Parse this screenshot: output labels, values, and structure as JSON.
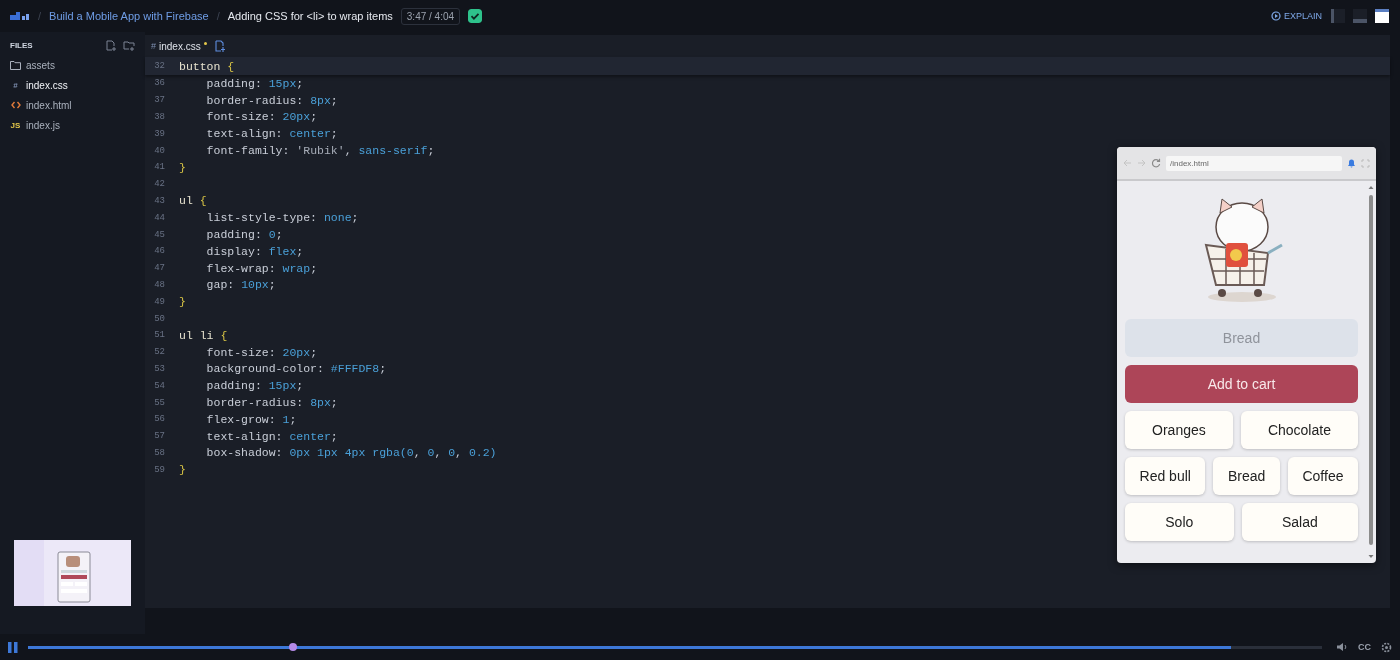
{
  "topbar": {
    "separator": "/",
    "breadcrumb": [
      {
        "label": "Build a Mobile App with Firebase",
        "kind": "link"
      },
      {
        "label": "Adding CSS for <li> to wrap items",
        "kind": "current"
      }
    ],
    "time": "3:47 / 4:04",
    "completed": true,
    "explain_label": "EXPLAIN"
  },
  "sidebar": {
    "title": "FILES",
    "files": [
      {
        "name": "assets",
        "kind": "folder",
        "selected": false
      },
      {
        "name": "index.css",
        "kind": "css",
        "glyph": "#",
        "selected": true
      },
      {
        "name": "index.html",
        "kind": "html",
        "selected": false
      },
      {
        "name": "index.js",
        "kind": "js",
        "glyph": "JS",
        "selected": false
      }
    ]
  },
  "editor": {
    "tab": {
      "glyph": "#",
      "name": "index.css",
      "modified": true
    },
    "sticky_line": {
      "num": "32",
      "code": "button {"
    },
    "lines": [
      {
        "num": "36",
        "code": "    padding: 15px;"
      },
      {
        "num": "37",
        "code": "    border-radius: 8px;"
      },
      {
        "num": "38",
        "code": "    font-size: 20px;"
      },
      {
        "num": "39",
        "code": "    text-align: center;"
      },
      {
        "num": "40",
        "code": "    font-family: 'Rubik', sans-serif;"
      },
      {
        "num": "41",
        "code": "}"
      },
      {
        "num": "42"
      },
      {
        "num": "43",
        "code": "ul {"
      },
      {
        "num": "44",
        "code": "    list-style-type: none;"
      },
      {
        "num": "45",
        "code": "    padding: 0;"
      },
      {
        "num": "46",
        "code": "    display: flex;"
      },
      {
        "num": "47",
        "code": "    flex-wrap: wrap;"
      },
      {
        "num": "48",
        "code": "    gap: 10px;"
      },
      {
        "num": "49",
        "code": "}"
      },
      {
        "num": "50"
      },
      {
        "num": "51",
        "code": "ul li {"
      },
      {
        "num": "52",
        "code": "    font-size: 20px;"
      },
      {
        "num": "53",
        "code": "    background-color: #FFFDF8;"
      },
      {
        "num": "54",
        "code": "    padding: 15px;"
      },
      {
        "num": "55",
        "code": "    border-radius: 8px;"
      },
      {
        "num": "56",
        "code": "    flex-grow: 1;"
      },
      {
        "num": "57",
        "code": "    text-align: center;"
      },
      {
        "num": "58",
        "code": "    box-shadow: 0px 1px 4px rgba(0, 0, 0, 0.2)"
      },
      {
        "num": "59",
        "code": "}"
      }
    ]
  },
  "preview": {
    "url": "/index.html",
    "input": {
      "placeholder": "Bread"
    },
    "button": "Add to cart",
    "item_rows": [
      [
        "Oranges",
        "Chocolate"
      ],
      [
        "Red bull",
        "Bread",
        "Coffee"
      ],
      [
        "Solo",
        "Salad"
      ]
    ]
  },
  "player": {
    "playing": true,
    "progress": {
      "level": 0.93
    },
    "marker": {
      "level": 0.205
    },
    "captions_label": "CC"
  }
}
